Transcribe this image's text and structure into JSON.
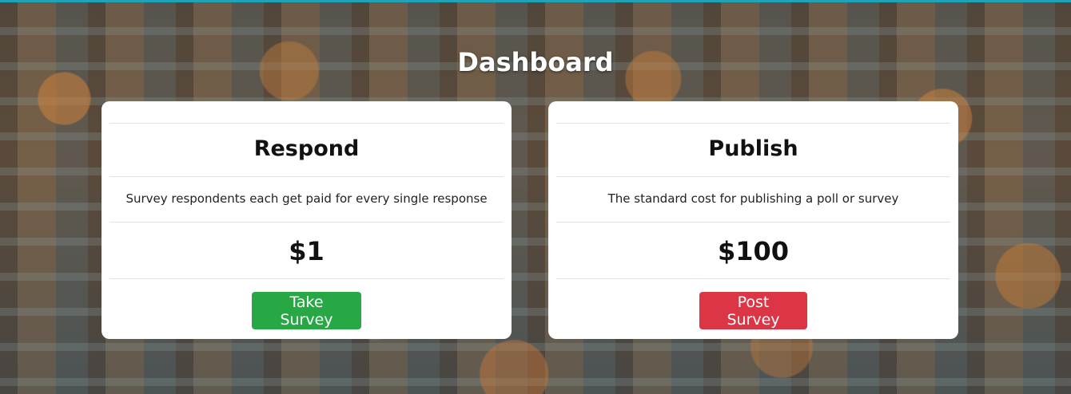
{
  "page": {
    "title": "Dashboard",
    "accent_color": "#1fa3b8"
  },
  "cards": [
    {
      "heading": "Respond",
      "description": "Survey respondents each get paid for every single response",
      "price": "$1",
      "button_label": "Take Survey",
      "button_color": "#28a745"
    },
    {
      "heading": "Publish",
      "description": "The standard cost for publishing a poll or survey",
      "price": "$100",
      "button_label": "Post Survey",
      "button_color": "#dc3545"
    }
  ]
}
